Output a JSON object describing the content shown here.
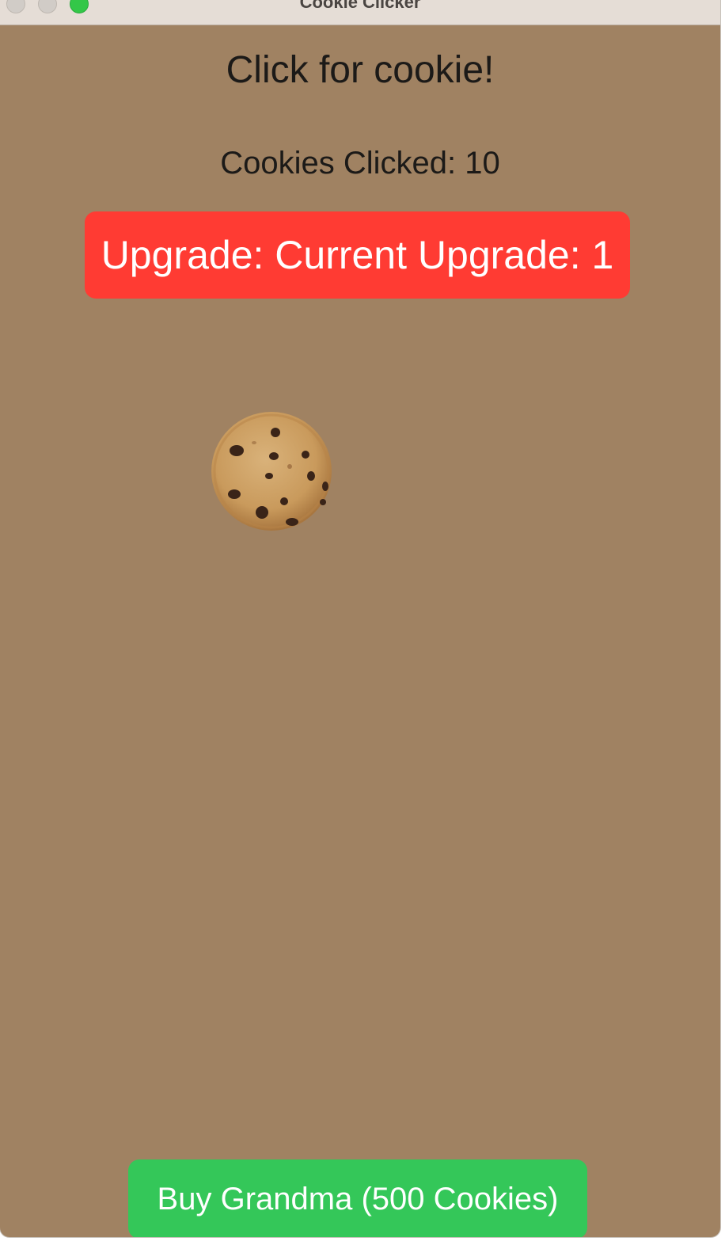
{
  "window": {
    "title": "Cookie Clicker"
  },
  "main": {
    "heading": "Click for cookie!",
    "counter_text": "Cookies Clicked: 10",
    "upgrade_button_label": "Upgrade: Current Upgrade: 1",
    "grandma_button_label": "Buy Grandma (500 Cookies)"
  },
  "icons": {
    "close": "close-icon",
    "minimize": "minimize-icon",
    "zoom": "zoom-icon",
    "cookie": "cookie-icon"
  },
  "colors": {
    "background": "#a08262",
    "upgrade_button": "#ff3b33",
    "grandma_button": "#34c759",
    "titlebar": "#e5ddd6"
  }
}
